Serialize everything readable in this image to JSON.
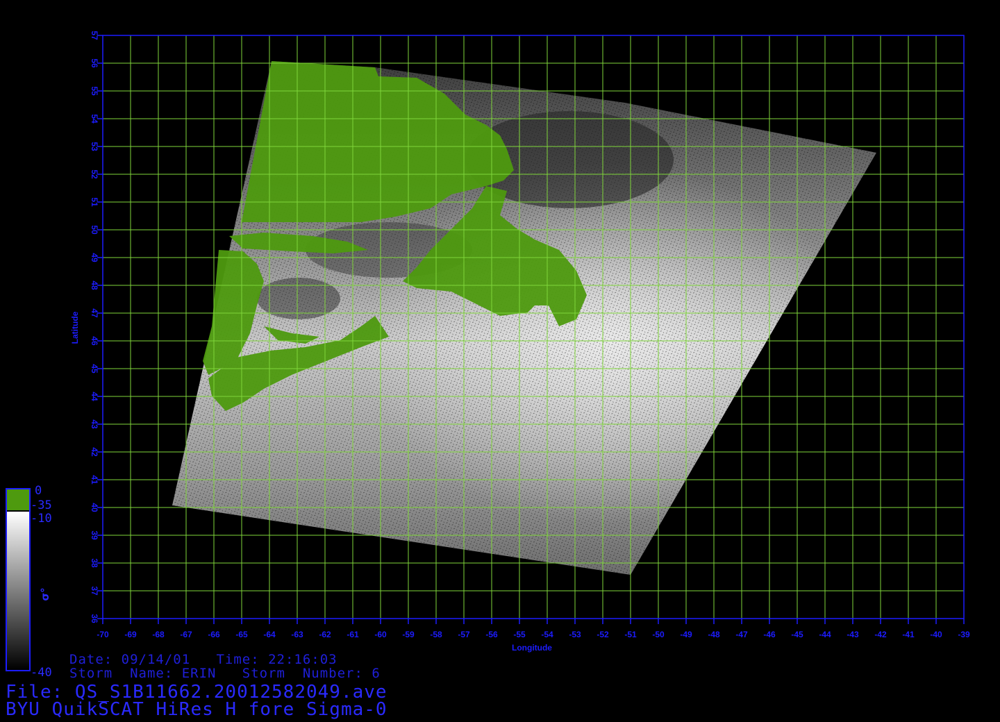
{
  "map": {
    "lon_range": [
      -70,
      -39
    ],
    "lat_range": [
      36,
      57
    ],
    "lon_ticks": [
      "-70",
      "-69",
      "-68",
      "-67",
      "-66",
      "-65",
      "-64",
      "-63",
      "-62",
      "-61",
      "-60",
      "-59",
      "-58",
      "-57",
      "-56",
      "-55",
      "-54",
      "-53",
      "-52",
      "-51",
      "-50",
      "-49",
      "-48",
      "-47",
      "-46",
      "-45",
      "-44",
      "-43",
      "-42",
      "-41",
      "-40",
      "-39"
    ],
    "lat_ticks": [
      "36",
      "37",
      "38",
      "39",
      "40",
      "41",
      "42",
      "43",
      "44",
      "45",
      "46",
      "47",
      "48",
      "49",
      "50",
      "51",
      "52",
      "53",
      "54",
      "55",
      "56",
      "57"
    ],
    "xlabel": "Longitude",
    "ylabel": "Latitude",
    "grid": true,
    "colors": {
      "frame": "#1c1cff",
      "grid": "#7fd63a",
      "land": "#4e9a0f",
      "background": "#000000"
    }
  },
  "colorbar": {
    "land_top": "0",
    "land_bottom": "-35",
    "top": "-10",
    "bottom": "-40",
    "label": "σ°"
  },
  "footer": {
    "date_line": "Date: 09/14/01   Time: 22:16:03",
    "storm_line": "Storm  Name: ERIN   Storm  Number: 6",
    "file_line": "File: QS_S1B11662.20012582049.ave",
    "product_line": "BYU QuikSCAT HiRes H fore Sigma-0"
  }
}
